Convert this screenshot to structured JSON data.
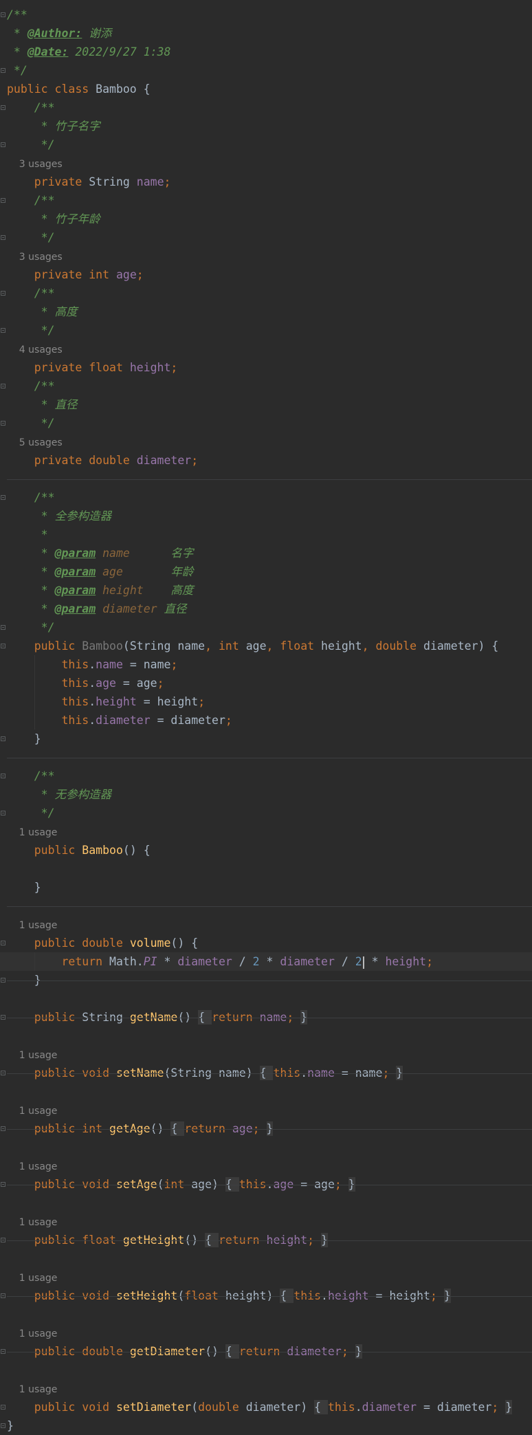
{
  "colors": {
    "background": "#2b2b2b",
    "default_text": "#a9b7c6",
    "keyword": "#cc7832",
    "field": "#9876aa",
    "doc_comment": "#629755",
    "method": "#ffc66d",
    "number": "#6897bb",
    "inlay_hint": "#8a8a8a"
  },
  "icons": {
    "fold_marker": "fold-icon",
    "caret": "text-cursor"
  },
  "lines": [
    [
      [
        "cmt",
        "/**"
      ]
    ],
    [
      [
        "cmt",
        " * "
      ],
      [
        "tag",
        "@Author:"
      ],
      [
        "cmt",
        " 谢添"
      ]
    ],
    [
      [
        "cmt",
        " * "
      ],
      [
        "tag",
        "@Date:"
      ],
      [
        "cmt",
        " 2022/9/27 1:38"
      ]
    ],
    [
      [
        "cmt",
        " */"
      ]
    ],
    [
      [
        "kw",
        "public class "
      ],
      [
        "txt",
        "Bamboo {"
      ]
    ],
    [
      [
        "cmt",
        "    /**"
      ]
    ],
    [
      [
        "cmt",
        "     * 竹子名字"
      ]
    ],
    [
      [
        "cmt",
        "     */"
      ]
    ],
    [
      [
        "usage",
        "    3 usages"
      ]
    ],
    [
      [
        "kw",
        "    private "
      ],
      [
        "txt",
        "String "
      ],
      [
        "fld",
        "name"
      ],
      [
        "kw",
        ";"
      ]
    ],
    [
      [
        "cmt",
        "    /**"
      ]
    ],
    [
      [
        "cmt",
        "     * 竹子年龄"
      ]
    ],
    [
      [
        "cmt",
        "     */"
      ]
    ],
    [
      [
        "usage",
        "    3 usages"
      ]
    ],
    [
      [
        "kw",
        "    private int "
      ],
      [
        "fld",
        "age"
      ],
      [
        "kw",
        ";"
      ]
    ],
    [
      [
        "cmt",
        "    /**"
      ]
    ],
    [
      [
        "cmt",
        "     * 高度"
      ]
    ],
    [
      [
        "cmt",
        "     */"
      ]
    ],
    [
      [
        "usage",
        "    4 usages"
      ]
    ],
    [
      [
        "kw",
        "    private float "
      ],
      [
        "fld",
        "height"
      ],
      [
        "kw",
        ";"
      ]
    ],
    [
      [
        "cmt",
        "    /**"
      ]
    ],
    [
      [
        "cmt",
        "     * 直径"
      ]
    ],
    [
      [
        "cmt",
        "     */"
      ]
    ],
    [
      [
        "usage",
        "    5 usages"
      ]
    ],
    [
      [
        "kw",
        "    private double "
      ],
      [
        "fld",
        "diameter"
      ],
      [
        "kw",
        ";"
      ]
    ],
    [],
    [
      [
        "cmt",
        "    /**"
      ]
    ],
    [
      [
        "cmt",
        "     * 全参构造器"
      ]
    ],
    [
      [
        "cmt",
        "     *"
      ]
    ],
    [
      [
        "cmt",
        "     * "
      ],
      [
        "tag",
        "@param"
      ],
      [
        "pname",
        " name     "
      ],
      [
        "cmt",
        " 名字"
      ]
    ],
    [
      [
        "cmt",
        "     * "
      ],
      [
        "tag",
        "@param"
      ],
      [
        "pname",
        " age      "
      ],
      [
        "cmt",
        " 年龄"
      ]
    ],
    [
      [
        "cmt",
        "     * "
      ],
      [
        "tag",
        "@param"
      ],
      [
        "pname",
        " height   "
      ],
      [
        "cmt",
        " 高度"
      ]
    ],
    [
      [
        "cmt",
        "     * "
      ],
      [
        "tag",
        "@param"
      ],
      [
        "pname",
        " diameter "
      ],
      [
        "cmt",
        "直径"
      ]
    ],
    [
      [
        "cmt",
        "     */"
      ]
    ],
    [
      [
        "kw",
        "    public "
      ],
      [
        "dimname",
        "Bamboo"
      ],
      [
        "txt",
        "(String name"
      ],
      [
        "kw",
        ", int "
      ],
      [
        "txt",
        "age"
      ],
      [
        "kw",
        ", float "
      ],
      [
        "txt",
        "height"
      ],
      [
        "kw",
        ", double "
      ],
      [
        "txt",
        "diameter) {"
      ]
    ],
    [
      [
        "kw",
        "        this"
      ],
      [
        "txt",
        "."
      ],
      [
        "fld",
        "name "
      ],
      [
        "txt",
        "= name"
      ],
      [
        "kw",
        ";"
      ]
    ],
    [
      [
        "kw",
        "        this"
      ],
      [
        "txt",
        "."
      ],
      [
        "fld",
        "age "
      ],
      [
        "txt",
        "= age"
      ],
      [
        "kw",
        ";"
      ]
    ],
    [
      [
        "kw",
        "        this"
      ],
      [
        "txt",
        "."
      ],
      [
        "fld",
        "height "
      ],
      [
        "txt",
        "= height"
      ],
      [
        "kw",
        ";"
      ]
    ],
    [
      [
        "kw",
        "        this"
      ],
      [
        "txt",
        "."
      ],
      [
        "fld",
        "diameter "
      ],
      [
        "txt",
        "= diameter"
      ],
      [
        "kw",
        ";"
      ]
    ],
    [
      [
        "txt",
        "    }"
      ]
    ],
    [],
    [
      [
        "cmt",
        "    /**"
      ]
    ],
    [
      [
        "cmt",
        "     * 无参构造器"
      ]
    ],
    [
      [
        "cmt",
        "     */"
      ]
    ],
    [
      [
        "usage",
        "    1 usage"
      ]
    ],
    [
      [
        "kw",
        "    public "
      ],
      [
        "fn",
        "Bamboo"
      ],
      [
        "txt",
        "() {"
      ]
    ],
    [],
    [
      [
        "txt",
        "    }"
      ]
    ],
    [],
    [
      [
        "usage",
        "    1 usage"
      ]
    ],
    [
      [
        "kw",
        "    public double "
      ],
      [
        "fn",
        "volume"
      ],
      [
        "txt",
        "() {"
      ]
    ],
    [
      [
        "kw",
        "        return "
      ],
      [
        "txt",
        "Math."
      ],
      [
        "fldi",
        "PI"
      ],
      [
        "txt",
        " * "
      ],
      [
        "fld",
        "diameter"
      ],
      [
        "txt",
        " / "
      ],
      [
        "num",
        "2"
      ],
      [
        "txt",
        " * "
      ],
      [
        "fld",
        "diameter"
      ],
      [
        "txt",
        " / "
      ],
      [
        "num",
        "2"
      ],
      [
        "caret",
        ""
      ],
      [
        "txt",
        " * "
      ],
      [
        "fld",
        "height"
      ],
      [
        "kw",
        ";"
      ]
    ],
    [
      [
        "txt",
        "    }"
      ]
    ],
    [],
    [
      [
        "kw",
        "    public "
      ],
      [
        "txt",
        "String "
      ],
      [
        "fn",
        "getName"
      ],
      [
        "txt",
        "() "
      ],
      [
        "chip",
        "{ "
      ],
      [
        "kw",
        "return "
      ],
      [
        "fld",
        "name"
      ],
      [
        "kw",
        "; "
      ],
      [
        "chip",
        "}"
      ]
    ],
    [],
    [
      [
        "usage",
        "    1 usage"
      ]
    ],
    [
      [
        "kw",
        "    public void "
      ],
      [
        "fn",
        "setName"
      ],
      [
        "txt",
        "(String name) "
      ],
      [
        "chip",
        "{ "
      ],
      [
        "kw",
        "this"
      ],
      [
        "txt",
        "."
      ],
      [
        "fld",
        "name"
      ],
      [
        "txt",
        " = name"
      ],
      [
        "kw",
        "; "
      ],
      [
        "chip",
        "}"
      ]
    ],
    [],
    [
      [
        "usage",
        "    1 usage"
      ]
    ],
    [
      [
        "kw",
        "    public int "
      ],
      [
        "fn",
        "getAge"
      ],
      [
        "txt",
        "() "
      ],
      [
        "chip",
        "{ "
      ],
      [
        "kw",
        "return "
      ],
      [
        "fld",
        "age"
      ],
      [
        "kw",
        "; "
      ],
      [
        "chip",
        "}"
      ]
    ],
    [],
    [
      [
        "usage",
        "    1 usage"
      ]
    ],
    [
      [
        "kw",
        "    public void "
      ],
      [
        "fn",
        "setAge"
      ],
      [
        "txt",
        "("
      ],
      [
        "kw",
        "int "
      ],
      [
        "txt",
        "age) "
      ],
      [
        "chip",
        "{ "
      ],
      [
        "kw",
        "this"
      ],
      [
        "txt",
        "."
      ],
      [
        "fld",
        "age"
      ],
      [
        "txt",
        " = age"
      ],
      [
        "kw",
        "; "
      ],
      [
        "chip",
        "}"
      ]
    ],
    [],
    [
      [
        "usage",
        "    1 usage"
      ]
    ],
    [
      [
        "kw",
        "    public float "
      ],
      [
        "fn",
        "getHeight"
      ],
      [
        "txt",
        "() "
      ],
      [
        "chip",
        "{ "
      ],
      [
        "kw",
        "return "
      ],
      [
        "fld",
        "height"
      ],
      [
        "kw",
        "; "
      ],
      [
        "chip",
        "}"
      ]
    ],
    [],
    [
      [
        "usage",
        "    1 usage"
      ]
    ],
    [
      [
        "kw",
        "    public void "
      ],
      [
        "fn",
        "setHeight"
      ],
      [
        "txt",
        "("
      ],
      [
        "kw",
        "float "
      ],
      [
        "txt",
        "height) "
      ],
      [
        "chip",
        "{ "
      ],
      [
        "kw",
        "this"
      ],
      [
        "txt",
        "."
      ],
      [
        "fld",
        "height"
      ],
      [
        "txt",
        " = height"
      ],
      [
        "kw",
        "; "
      ],
      [
        "chip",
        "}"
      ]
    ],
    [],
    [
      [
        "usage",
        "    1 usage"
      ]
    ],
    [
      [
        "kw",
        "    public double "
      ],
      [
        "fn",
        "getDiameter"
      ],
      [
        "txt",
        "() "
      ],
      [
        "chip",
        "{ "
      ],
      [
        "kw",
        "return "
      ],
      [
        "fld",
        "diameter"
      ],
      [
        "kw",
        "; "
      ],
      [
        "chip",
        "}"
      ]
    ],
    [],
    [
      [
        "usage",
        "    1 usage"
      ]
    ],
    [
      [
        "kw",
        "    public void "
      ],
      [
        "fn",
        "setDiameter"
      ],
      [
        "txt",
        "("
      ],
      [
        "kw",
        "double "
      ],
      [
        "txt",
        "diameter) "
      ],
      [
        "chip",
        "{ "
      ],
      [
        "kw",
        "this"
      ],
      [
        "txt",
        "."
      ],
      [
        "fld",
        "diameter"
      ],
      [
        "txt",
        " = diameter"
      ],
      [
        "kw",
        "; "
      ],
      [
        "chip",
        "}"
      ]
    ],
    [
      [
        "txt",
        "}"
      ]
    ]
  ]
}
